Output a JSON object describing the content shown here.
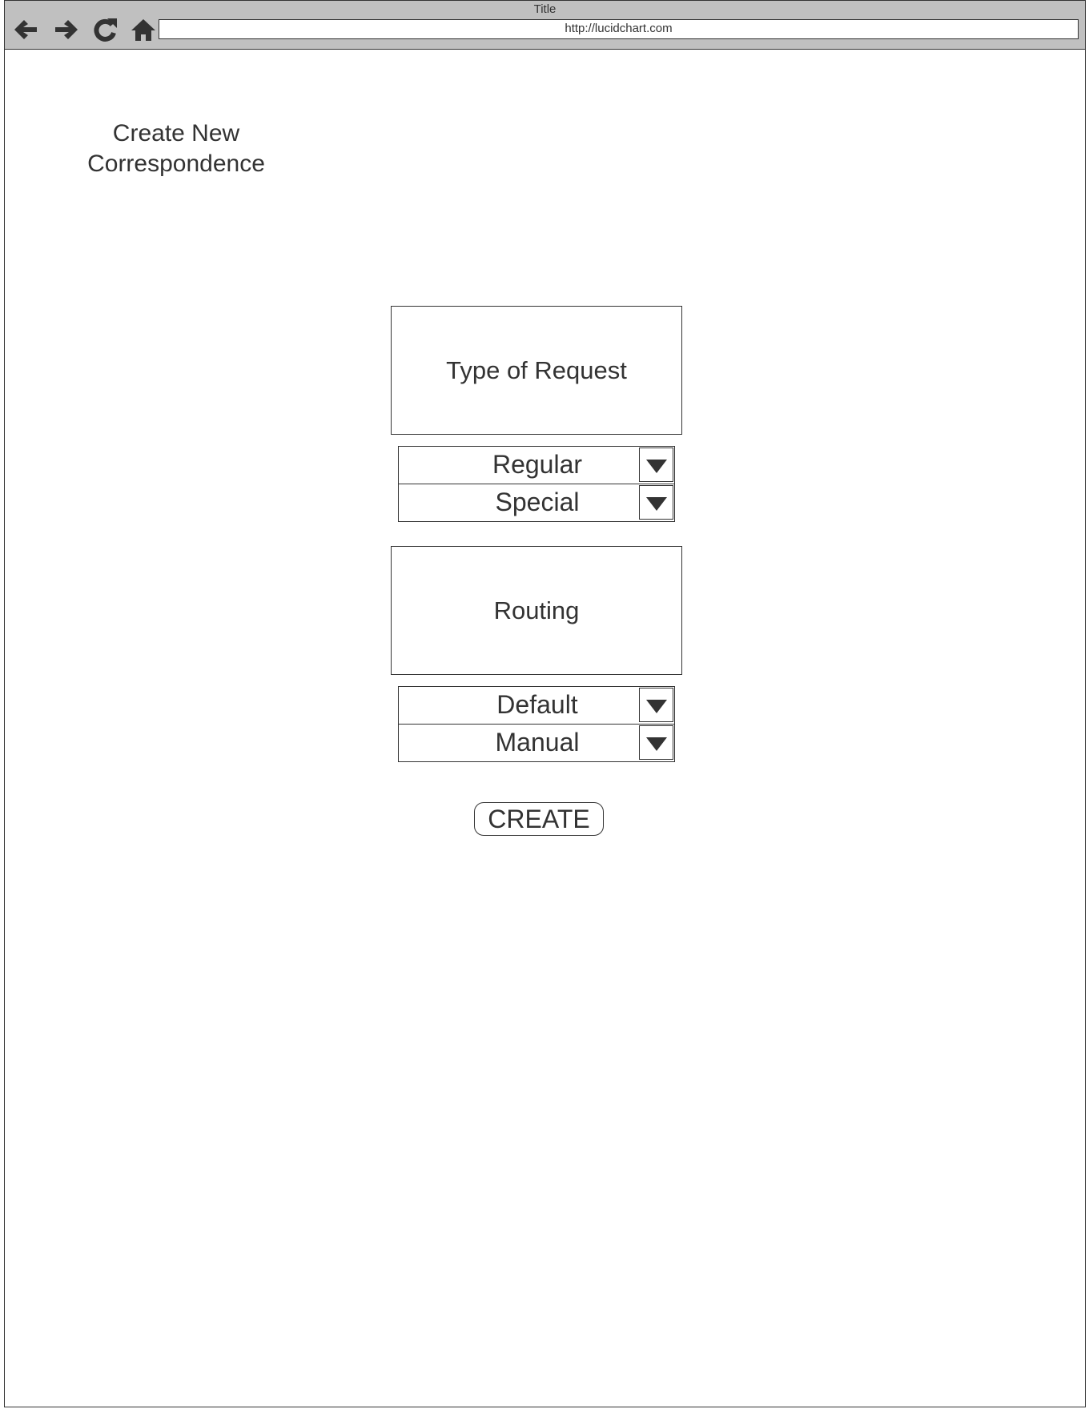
{
  "browser": {
    "window_title": "Title",
    "url": "http://lucidchart.com",
    "nav_icons": [
      "back-arrow-icon",
      "forward-arrow-icon",
      "reload-icon",
      "home-icon"
    ]
  },
  "page": {
    "heading": "Create New Correspondence",
    "request_section": {
      "title": "Type of Request",
      "dropdowns": [
        "Regular",
        "Special"
      ]
    },
    "routing_section": {
      "title": "Routing",
      "dropdowns": [
        "Default",
        "Manual"
      ]
    },
    "create_button": "CREATE"
  }
}
